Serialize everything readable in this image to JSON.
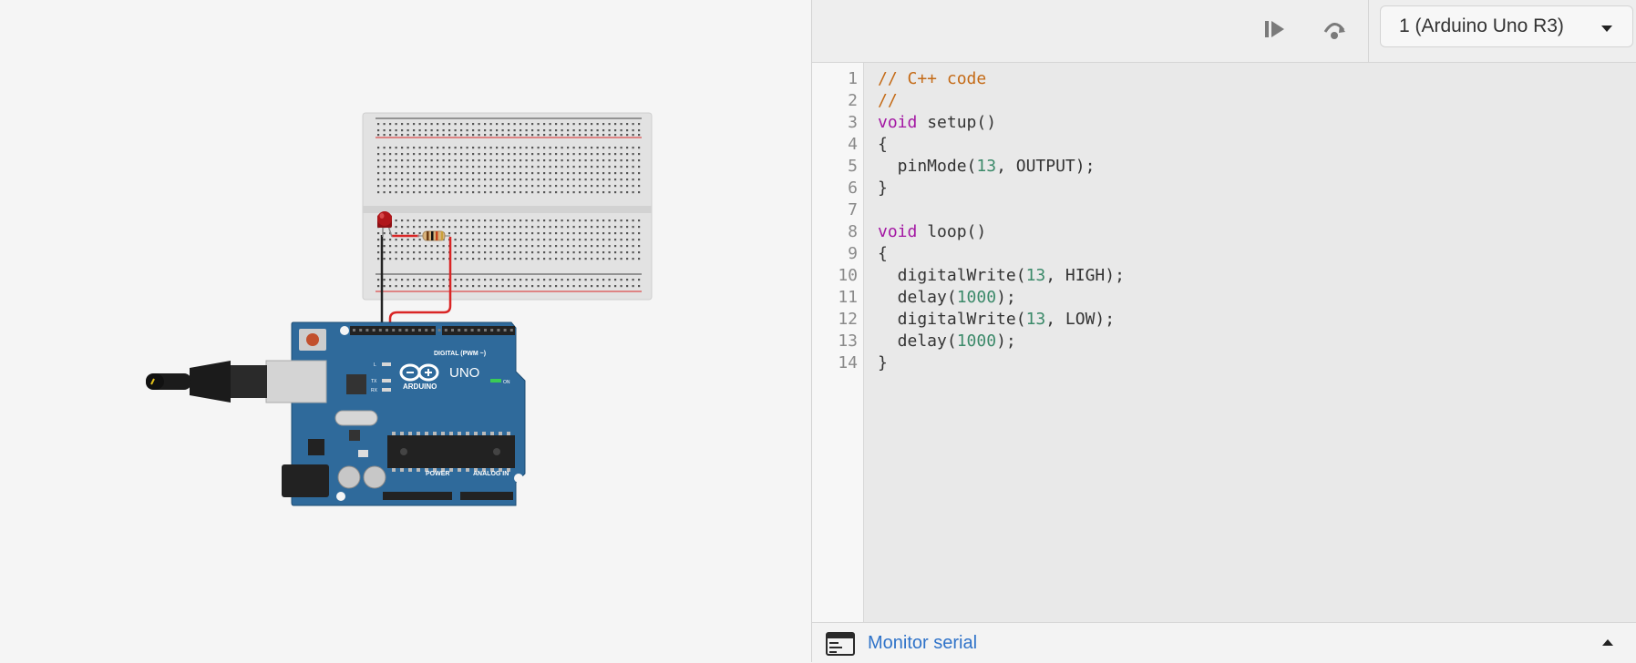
{
  "toolbar": {
    "start_icon": "step-play-icon",
    "step_over_icon": "step-over-icon",
    "device_select_value": "1 (Arduino Uno R3)"
  },
  "circuit": {
    "board_logo_text": "ARDUINO",
    "board_model": "UNO",
    "digital_label": "DIGITAL (PWM ~)",
    "power_label": "POWER",
    "analog_label": "ANALOG IN",
    "on_label": "ON",
    "led_labels": [
      "L",
      "TX",
      "RX"
    ],
    "colors": {
      "board": "#2f6a9b",
      "wire_red": "#d92525",
      "wire_black": "#222222",
      "led": "#b0161a",
      "breadboard": "#e2e2e2"
    }
  },
  "editor": {
    "line_numbers": [
      "1",
      "2",
      "3",
      "4",
      "5",
      "6",
      "7",
      "8",
      "9",
      "10",
      "11",
      "12",
      "13",
      "14"
    ],
    "lines": [
      {
        "tokens": [
          {
            "t": "// C++ code",
            "c": "comment"
          }
        ]
      },
      {
        "tokens": [
          {
            "t": "//",
            "c": "comment"
          }
        ]
      },
      {
        "tokens": [
          {
            "t": "void",
            "c": "keyword"
          },
          {
            "t": " setup()",
            "c": ""
          }
        ]
      },
      {
        "tokens": [
          {
            "t": "{",
            "c": ""
          }
        ]
      },
      {
        "tokens": [
          {
            "t": "  pinMode(",
            "c": ""
          },
          {
            "t": "13",
            "c": "number"
          },
          {
            "t": ", OUTPUT);",
            "c": ""
          }
        ]
      },
      {
        "tokens": [
          {
            "t": "}",
            "c": ""
          }
        ]
      },
      {
        "tokens": []
      },
      {
        "tokens": [
          {
            "t": "void",
            "c": "keyword"
          },
          {
            "t": " loop()",
            "c": ""
          }
        ]
      },
      {
        "tokens": [
          {
            "t": "{",
            "c": ""
          }
        ]
      },
      {
        "tokens": [
          {
            "t": "  digitalWrite(",
            "c": ""
          },
          {
            "t": "13",
            "c": "number"
          },
          {
            "t": ", HIGH);",
            "c": ""
          }
        ]
      },
      {
        "tokens": [
          {
            "t": "  delay(",
            "c": ""
          },
          {
            "t": "1000",
            "c": "number"
          },
          {
            "t": ");",
            "c": ""
          }
        ]
      },
      {
        "tokens": [
          {
            "t": "  digitalWrite(",
            "c": ""
          },
          {
            "t": "13",
            "c": "number"
          },
          {
            "t": ", LOW);",
            "c": ""
          }
        ]
      },
      {
        "tokens": [
          {
            "t": "  delay(",
            "c": ""
          },
          {
            "t": "1000",
            "c": "number"
          },
          {
            "t": ");",
            "c": ""
          }
        ]
      },
      {
        "tokens": [
          {
            "t": "}",
            "c": ""
          }
        ]
      }
    ]
  },
  "serial": {
    "label": "Monitor serial",
    "icon": "serial-window-icon",
    "toggle_icon": "chevron-up-icon"
  }
}
